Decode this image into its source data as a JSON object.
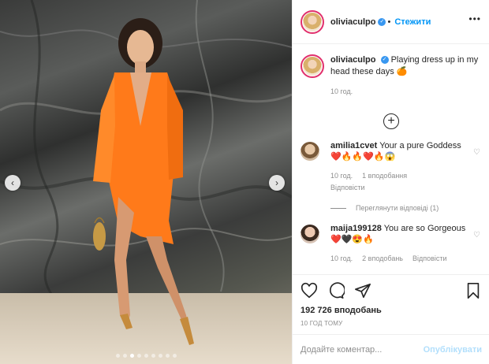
{
  "photo": {
    "prev_icon": "chevron-left-icon",
    "next_icon": "chevron-right-icon",
    "slide_count": 9,
    "active_slide": 3
  },
  "header": {
    "username": "oliviaculpo",
    "separator": "•",
    "follow_label": "Стежити",
    "more_icon": "more-horizontal-icon"
  },
  "caption": {
    "username": "oliviaculpo",
    "text": "Playing dress up in my head these days 🍊",
    "time": "10 год."
  },
  "load_more_icon": "plus-circle-icon",
  "comments": [
    {
      "username": "amilia1cvet",
      "text": "Your a pure Goddess ❤️🔥🔥❤️🔥😱",
      "time": "10 год.",
      "likes": "1 вподобання",
      "reply_label": "Відповісти",
      "view_replies": "Переглянути відповіді (1)"
    },
    {
      "username": "maija199128",
      "text": "You are so Gorgeous ❤️🖤😍🔥",
      "time": "10 год.",
      "likes": "2 вподобань",
      "reply_label": "Відповісти"
    }
  ],
  "actions": {
    "like_icon": "heart-icon",
    "comment_icon": "comment-icon",
    "share_icon": "share-icon",
    "save_icon": "bookmark-icon",
    "likes_count": "192 726 вподобань",
    "posted": "10 ГОД ТОМУ"
  },
  "add_comment": {
    "placeholder": "Додайте коментар...",
    "publish_label": "Опублікувати"
  },
  "colors": {
    "link_blue": "#0095f6",
    "publish_disabled": "#b2dffc",
    "muted_text": "#8e8e8e",
    "dress_orange": "#ff7a1a"
  }
}
